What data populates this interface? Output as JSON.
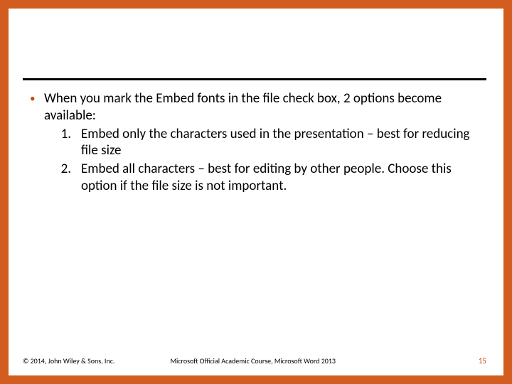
{
  "bullet": {
    "lead": "When you mark the Embed fonts in the file check box, 2 options become available:",
    "items": [
      {
        "num": "1.",
        "text": "Embed only the characters used in the presentation – best for reducing file size"
      },
      {
        "num": "2.",
        "text": "Embed all characters – best for editing by other people. Choose this option if the file size is not important."
      }
    ]
  },
  "footer": {
    "copyright": "© 2014, John Wiley & Sons, Inc.",
    "course": "Microsoft Official Academic Course, Microsoft Word 2013",
    "page": "15"
  }
}
